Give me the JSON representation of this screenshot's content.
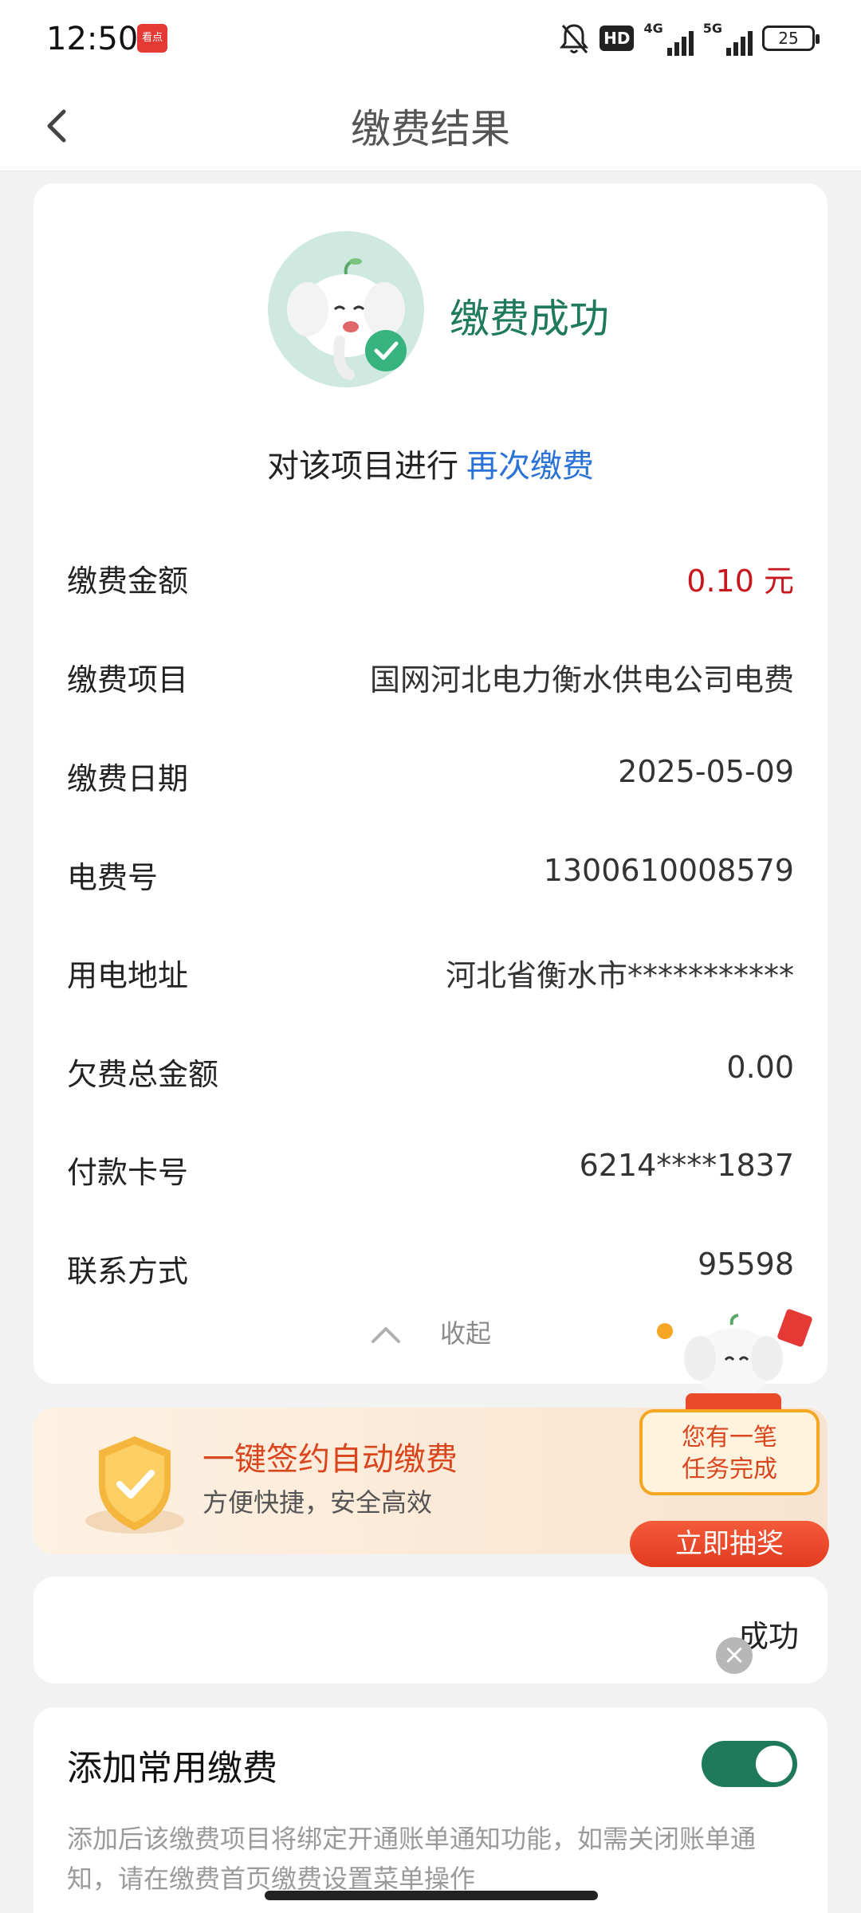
{
  "status_bar": {
    "time": "12:50",
    "app_badge": "看点",
    "hd_label": "HD",
    "net1": "4G",
    "net2": "5G",
    "battery": "25"
  },
  "nav": {
    "title": "缴费结果"
  },
  "result": {
    "status": "缴费成功",
    "again_prefix": "对该项目进行",
    "again_link": "再次缴费"
  },
  "details": [
    {
      "label": "缴费金额",
      "value": "0.10 元"
    },
    {
      "label": "缴费项目",
      "value": "国网河北电力衡水供电公司电费"
    },
    {
      "label": "缴费日期",
      "value": "2025-05-09"
    },
    {
      "label": "电费号",
      "value": "1300610008579"
    },
    {
      "label": "用电地址",
      "value": "河北省衡水市***********"
    },
    {
      "label": "欠费总金额",
      "value": "0.00"
    },
    {
      "label": "付款卡号",
      "value": "6214****1837"
    },
    {
      "label": "联系方式",
      "value": "95598"
    }
  ],
  "collapse_label": "收起",
  "banner": {
    "title": "一键签约自动缴费",
    "subtitle": "方便快捷，安全高效"
  },
  "promo": {
    "line1": "您有一笔",
    "line2": "任务完成",
    "button": "立即抽奖"
  },
  "small_card": {
    "text": "成功"
  },
  "add_common": {
    "title": "添加常用缴费",
    "toggle_on": true,
    "description": "添加后该缴费项目将绑定开通账单通知功能，如需关闭账单通知，请在缴费首页缴费设置菜单操作"
  },
  "colors": {
    "accent_green": "#1e7a5a",
    "link_blue": "#2a72d6",
    "amount_red": "#c8161d",
    "banner_orange": "#d9461e"
  }
}
